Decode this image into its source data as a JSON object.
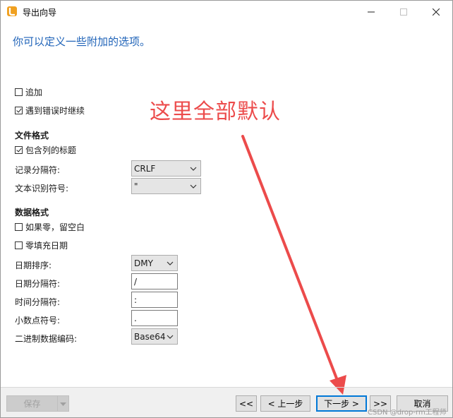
{
  "window": {
    "title": "导出向导",
    "header": "你可以定义一些附加的选项。"
  },
  "annotation": {
    "text": "这里全部默认",
    "color": "#ec4b4b"
  },
  "options": {
    "append_label": "追加",
    "append_checked": false,
    "continue_on_error_label": "遇到错误时继续",
    "continue_on_error_checked": true
  },
  "file_format": {
    "title": "文件格式",
    "include_headers_label": "包含列的标题",
    "include_headers_checked": true,
    "record_delimiter_label": "记录分隔符:",
    "record_delimiter_value": "CRLF",
    "text_qualifier_label": "文本识别符号:",
    "text_qualifier_value": "\""
  },
  "data_format": {
    "title": "数据格式",
    "blank_if_zero_label": "如果零，留空白",
    "blank_if_zero_checked": false,
    "zero_pad_date_label": "零填充日期",
    "zero_pad_date_checked": false,
    "date_order_label": "日期排序:",
    "date_order_value": "DMY",
    "date_delimiter_label": "日期分隔符:",
    "date_delimiter_value": "/",
    "time_delimiter_label": "时间分隔符:",
    "time_delimiter_value": ":",
    "decimal_symbol_label": "小数点符号:",
    "decimal_symbol_value": ".",
    "binary_encoding_label": "二进制数据编码:",
    "binary_encoding_value": "Base64"
  },
  "footer": {
    "save_label": "保存",
    "first_label": "<<",
    "prev_label": "< 上一步",
    "next_label": "下一步 >",
    "last_label": ">>",
    "cancel_label": "取消"
  },
  "watermark": "CSDN @drop-rm工程师",
  "colors": {
    "header_blue": "#1f63b8",
    "primary_border": "#0078d7"
  }
}
